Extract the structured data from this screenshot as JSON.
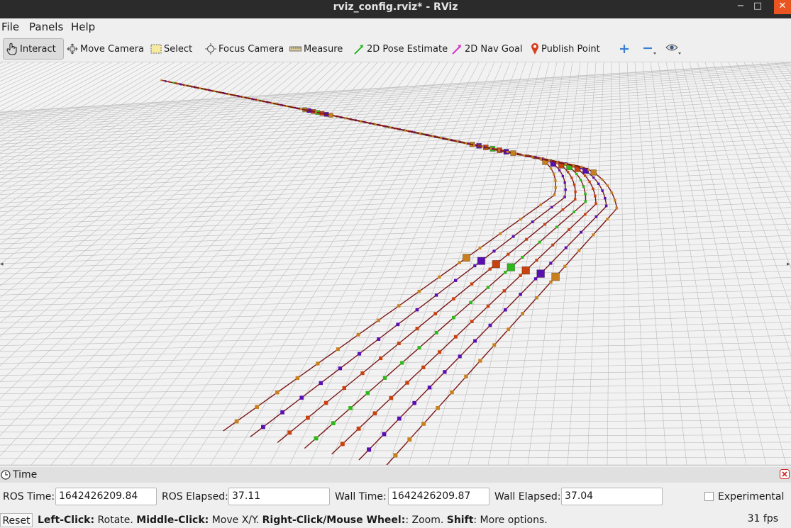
{
  "window": {
    "title": "rviz_config.rviz* - RViz",
    "minimize": "−",
    "maximize": "□",
    "close": "✕"
  },
  "menubar": {
    "items": [
      "File",
      "Panels",
      "Help"
    ]
  },
  "toolbar": {
    "tools": [
      {
        "label": "Interact",
        "icon": "hand-pointer-icon",
        "active": true
      },
      {
        "label": "Move Camera",
        "icon": "move-camera-icon"
      },
      {
        "label": "Select",
        "icon": "select-rectangle-icon"
      },
      {
        "label": "Focus Camera",
        "icon": "focus-camera-icon"
      },
      {
        "label": "Measure",
        "icon": "ruler-icon"
      },
      {
        "label": "2D Pose Estimate",
        "icon": "green-arrow-icon"
      },
      {
        "label": "2D Nav Goal",
        "icon": "magenta-arrow-icon"
      },
      {
        "label": "Publish Point",
        "icon": "map-pin-icon"
      }
    ],
    "extra_icons": [
      "plus-icon",
      "minus-icon",
      "eye-icon"
    ]
  },
  "viewport": {
    "grid_color": "#bcbcbc",
    "background": "#f2f2f2",
    "path_colors": {
      "orange": "#c8801e",
      "purple": "#5a0fb0",
      "red": "#c8420f",
      "green": "#2fb81a",
      "line": "#7a1818"
    }
  },
  "time_panel": {
    "title": "Time",
    "ros_time_label": "ROS Time:",
    "ros_time_value": "1642426209.84",
    "ros_elapsed_label": "ROS Elapsed:",
    "ros_elapsed_value": "37.11",
    "wall_time_label": "Wall Time:",
    "wall_time_value": "1642426209.87",
    "wall_elapsed_label": "Wall Elapsed:",
    "wall_elapsed_value": "37.04",
    "experimental_label": "Experimental"
  },
  "statusbar": {
    "reset_label": "Reset",
    "hint": {
      "left_click": "Left-Click:",
      "left_click_desc": " Rotate. ",
      "middle_click": "Middle-Click:",
      "middle_click_desc": " Move X/Y. ",
      "right_click": "Right-Click/Mouse Wheel:",
      "right_click_desc": ": Zoom. ",
      "shift": "Shift",
      "shift_desc": ": More options."
    },
    "fps": "31 fps"
  }
}
